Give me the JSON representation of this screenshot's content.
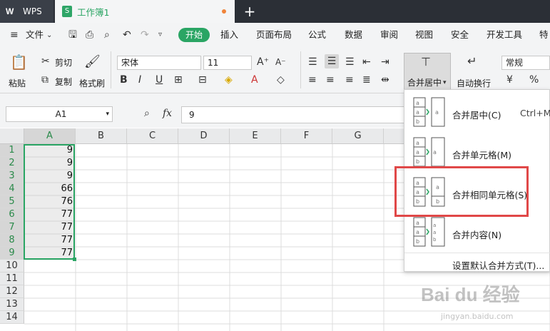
{
  "titlebar": {
    "app_name": "WPS",
    "doc_tab": "工作簿1",
    "new_tab": "+"
  },
  "menubar": {
    "file": "文件",
    "items": [
      "开始",
      "插入",
      "页面布局",
      "公式",
      "数据",
      "审阅",
      "视图",
      "安全",
      "开发工具",
      "特色"
    ]
  },
  "ribbon": {
    "paste": "粘贴",
    "cut": "剪切",
    "copy": "复制",
    "format_painter": "格式刷",
    "font_name": "宋体",
    "font_size": "11",
    "merge_center": "合并居中",
    "wrap_text": "自动换行",
    "number_format": "常规"
  },
  "formula": {
    "cell_ref": "A1",
    "fx": "fx",
    "content": "9"
  },
  "grid": {
    "columns": [
      "A",
      "B",
      "C",
      "D",
      "E",
      "F",
      "G"
    ],
    "rows": [
      "1",
      "2",
      "3",
      "4",
      "5",
      "6",
      "7",
      "8",
      "9",
      "10",
      "11",
      "12",
      "13",
      "14"
    ],
    "values": [
      "9",
      "9",
      "9",
      "66",
      "76",
      "77",
      "77",
      "77",
      "77"
    ]
  },
  "dropdown": {
    "items": [
      {
        "label": "合并居中(C)",
        "shortcut": "Ctrl+M"
      },
      {
        "label": "合并单元格(M)",
        "shortcut": ""
      },
      {
        "label": "合并相同单元格(S)",
        "shortcut": ""
      },
      {
        "label": "合并内容(N)",
        "shortcut": ""
      }
    ],
    "footer": "设置默认合并方式(T)..."
  },
  "watermark": {
    "main": "Bai du 经验",
    "sub": "jingyan.baidu.com"
  },
  "colors": {
    "accent": "#2aa564",
    "highlight": "#e04848",
    "titlebar": "#2b2f36"
  }
}
